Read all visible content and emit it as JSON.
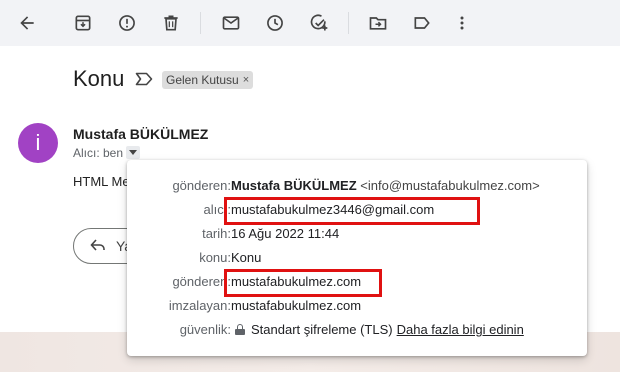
{
  "toolbar": {
    "icons": [
      "back-arrow-icon",
      "archive-icon",
      "report-spam-icon",
      "delete-icon",
      "mark-unread-icon",
      "snooze-icon",
      "add-task-icon",
      "move-to-icon",
      "label-icon",
      "more-vert-icon"
    ]
  },
  "subject": "Konu",
  "label_chip": {
    "text": "Gelen Kutusu",
    "close": "×"
  },
  "sender": {
    "avatar_letter": "i",
    "name": "Mustafa BÜKÜLMEZ",
    "to_line": "Alıcı: ben"
  },
  "preview_text": "HTML Me",
  "reply_button": "Ya",
  "details": {
    "from_label": "gönderen:",
    "from_name": "Mustafa BÜKÜLMEZ",
    "from_email": "<info@mustafabukulmez.com>",
    "to_label": "alıcı:",
    "to_value": "mustafabukulmez3446@gmail.com",
    "date_label": "tarih:",
    "date_value": "16 Ağu 2022 11:44",
    "subject_label": "konu:",
    "subject_value": "Konu",
    "mailedby_label": "gönderen:",
    "mailedby_value": "mustafabukulmez.com",
    "signedby_label": "imzalayan:",
    "signedby_value": "mustafabukulmez.com",
    "security_label": "güvenlik:",
    "security_value": "Standart şifreleme (TLS)",
    "security_link": "Daha fazla bilgi edinin"
  },
  "colors": {
    "avatar": "#a142c4",
    "highlight": "#e01111",
    "toolbar_bg": "#f2f3f6"
  }
}
